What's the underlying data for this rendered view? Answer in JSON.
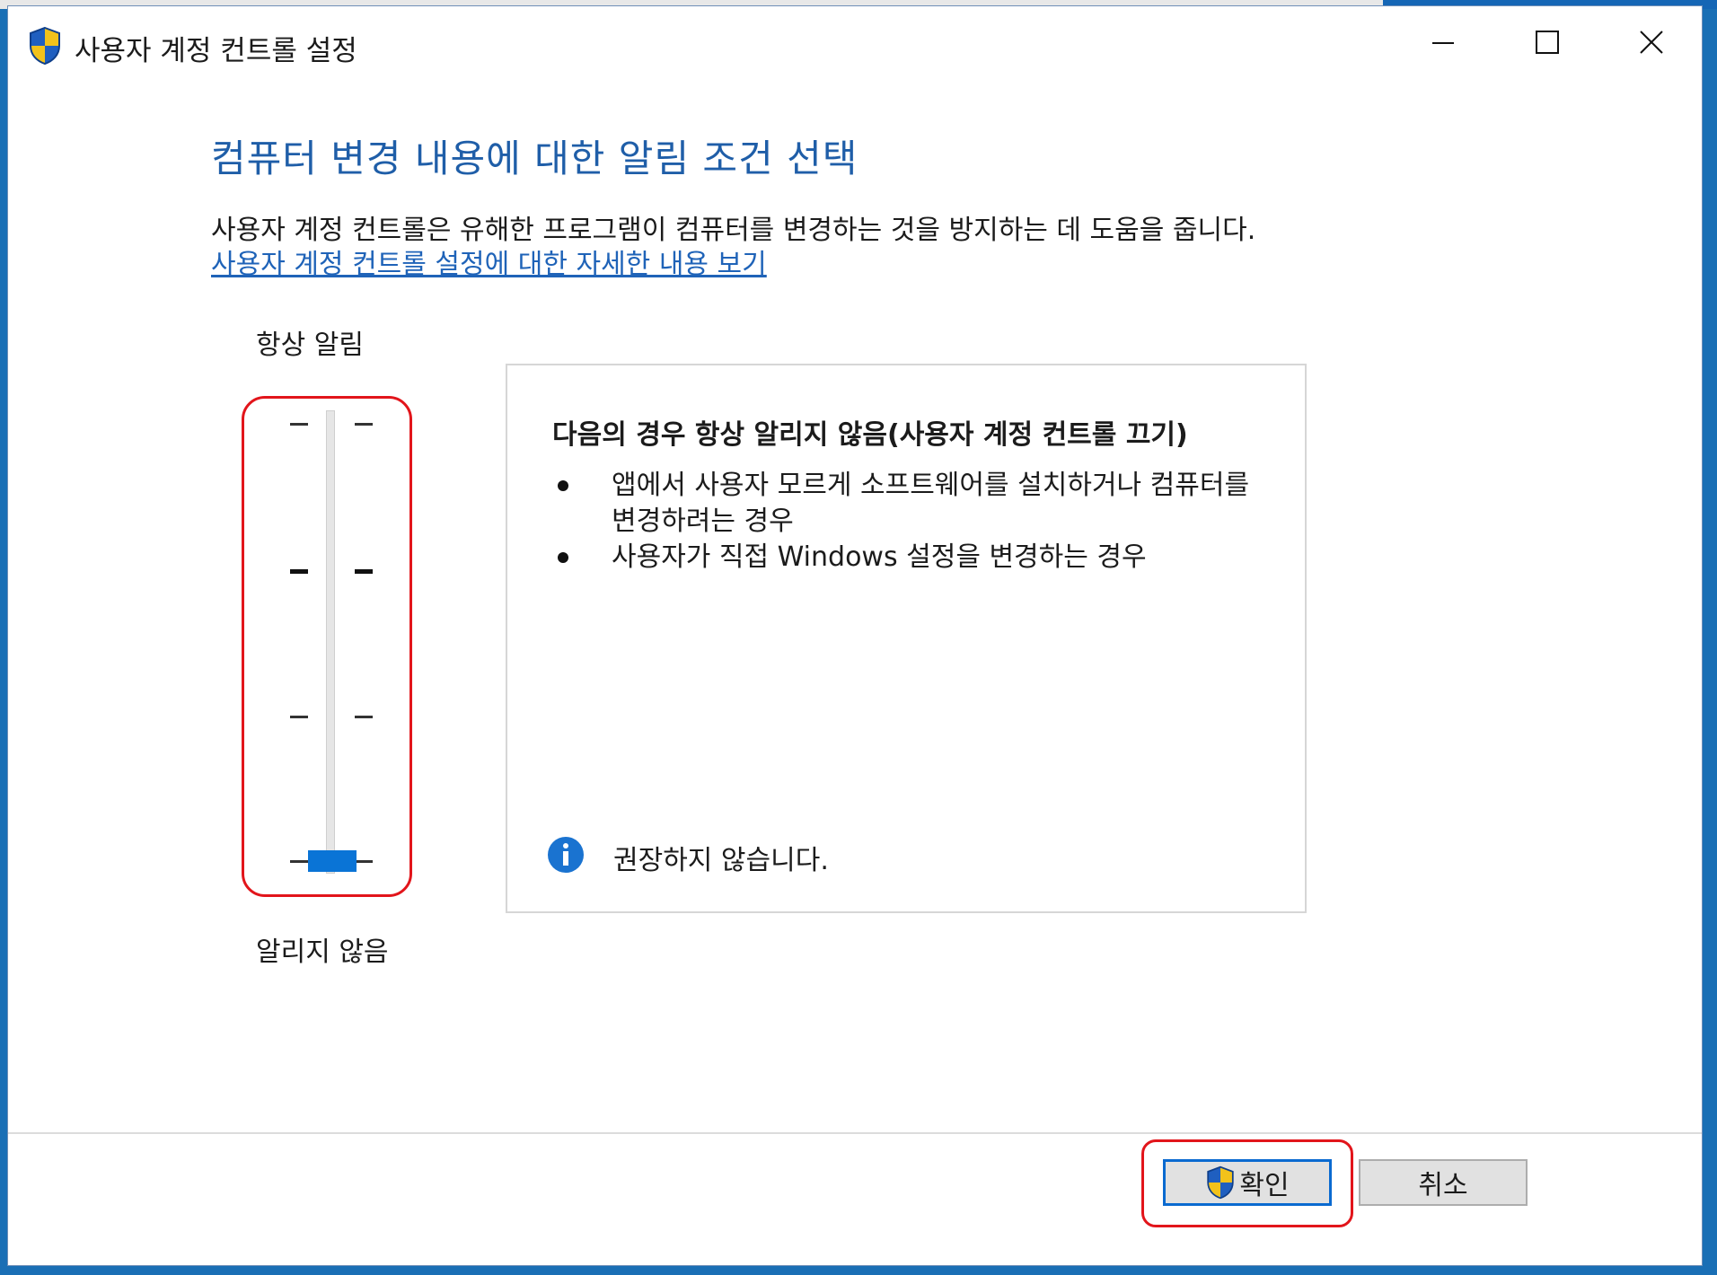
{
  "window": {
    "title": "사용자 계정 컨트롤 설정"
  },
  "main": {
    "heading": "컴퓨터 변경 내용에 대한 알림 조건 선택",
    "description": "사용자 계정 컨트롤은 유해한 프로그램이 컴퓨터를 변경하는 것을 방지하는 데 도움을 줍니다.",
    "more_link": "사용자 계정 컨트롤 설정에 대한 자세한 내용 보기"
  },
  "slider": {
    "top_label": "항상 알림",
    "bottom_label": "알리지 않음",
    "level_count": 4,
    "selected_level": 1
  },
  "info": {
    "title": "다음의 경우 항상 알리지 않음(사용자 계정 컨트롤 끄기)",
    "bullets": [
      "앱에서 사용자 모르게 소프트웨어를 설치하거나 컴퓨터를 변경하려는 경우",
      "사용자가 직접 Windows 설정을 변경하는 경우"
    ],
    "note": "권장하지 않습니다."
  },
  "buttons": {
    "ok": "확인",
    "cancel": "취소"
  },
  "colors": {
    "heading": "#1f5ea8",
    "link": "#1f63b8",
    "thumb": "#0a74d6",
    "highlight": "#e2151b"
  },
  "icons": {
    "title": "uac-shield-icon",
    "minimize": "minimize-icon",
    "maximize": "maximize-icon",
    "close": "close-icon",
    "info": "info-icon",
    "ok": "uac-shield-icon"
  }
}
